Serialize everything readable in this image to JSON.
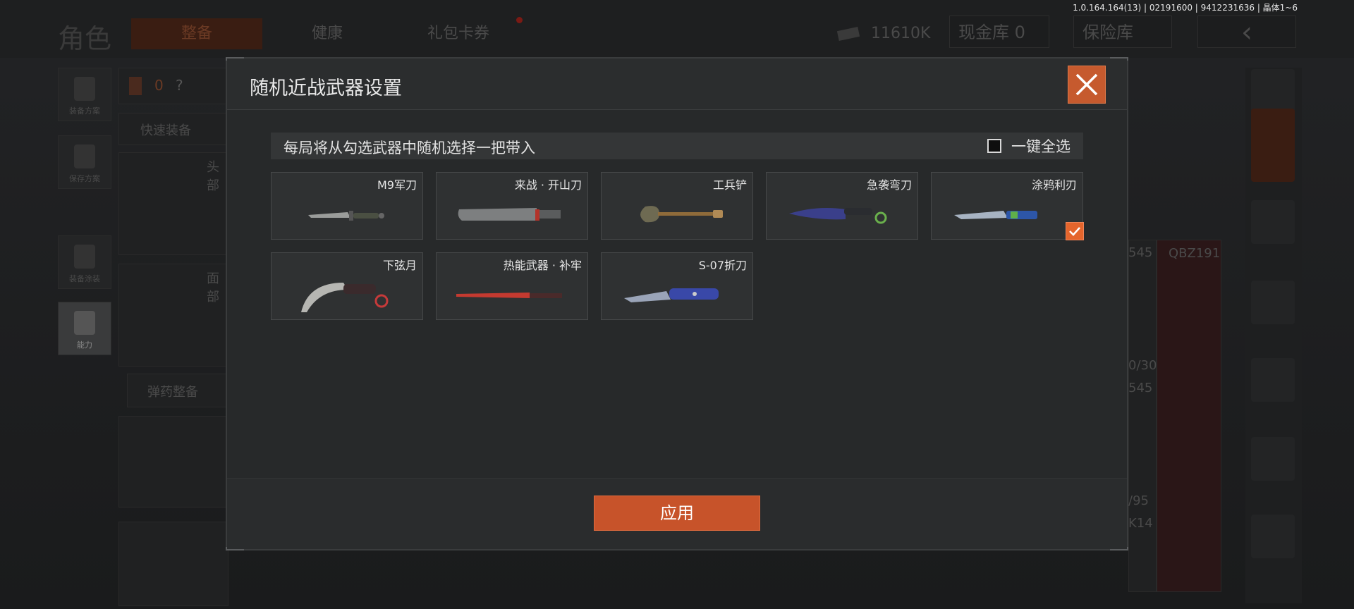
{
  "background": {
    "version": "1.0.164.164(13) | 02191600 | 9412231636 | 晶体1~6",
    "page_title": "角色",
    "tabs": [
      {
        "label": "整备"
      },
      {
        "label": "健康"
      },
      {
        "label": "礼包卡券"
      }
    ],
    "currency": "11610K",
    "cash_vault": "现金库 0",
    "safe_vault": "保险库",
    "left_menu": [
      {
        "label": "装备方案"
      },
      {
        "label": "保存方案"
      },
      {
        "label": "装备涂装"
      },
      {
        "label": "能力"
      }
    ],
    "armor_count": "0",
    "armor_help": "?",
    "quick_equip": "快速装备",
    "ammo_equip": "弹药整备",
    "head_label": "头部",
    "face_label": "面部",
    "weapon_labels": [
      "545",
      "QBZ191",
      "0/30",
      "545",
      "/95",
      "K14"
    ]
  },
  "modal": {
    "title": "随机近战武器设置",
    "banner_text": "每局将从勾选武器中随机选择一把带入",
    "select_all_label": "一键全选",
    "select_all_checked": false,
    "weapons": [
      {
        "name": "M9军刀",
        "checked": false
      },
      {
        "name": "来战 · 开山刀",
        "checked": false
      },
      {
        "name": "工兵铲",
        "checked": false
      },
      {
        "name": "急袭弯刀",
        "checked": false
      },
      {
        "name": "涂鸦利刃",
        "checked": true
      },
      {
        "name": "下弦月",
        "checked": false
      },
      {
        "name": "热能武器 · 补牢",
        "checked": false
      },
      {
        "name": "S-07折刀",
        "checked": false
      }
    ],
    "apply_label": "应用"
  },
  "colors": {
    "accent": "#c7532a",
    "check": "#e5652c"
  }
}
